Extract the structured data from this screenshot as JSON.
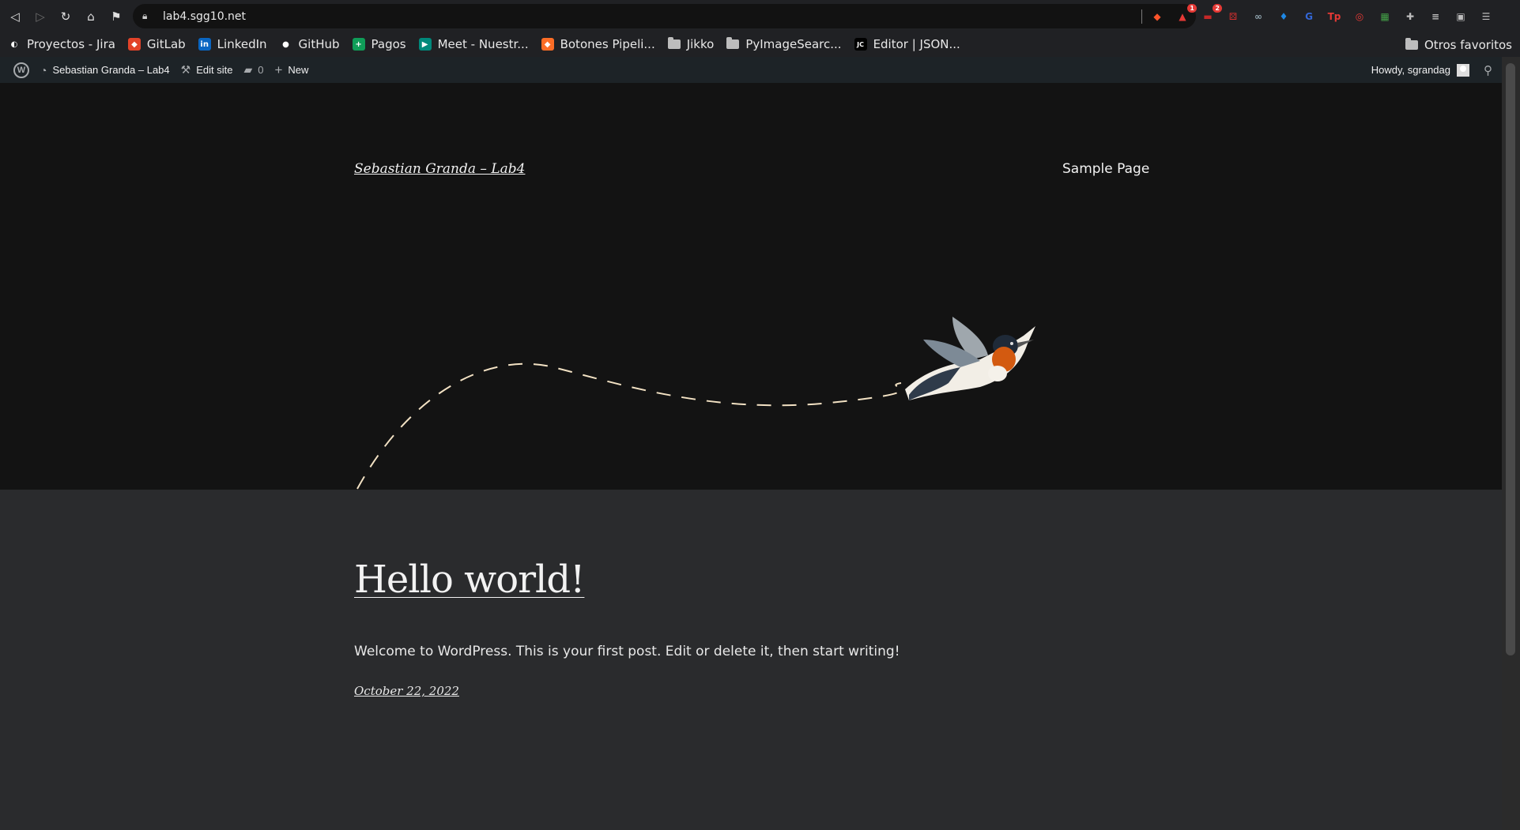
{
  "browser": {
    "url": "lab4.sgg10.net",
    "extensions": [
      {
        "name": "brave-icon",
        "color": "#fb542b",
        "glyph": "◆",
        "badge": ""
      },
      {
        "name": "alert-icon",
        "color": "#e53935",
        "glyph": "▲",
        "badge": "1"
      },
      {
        "name": "dashes-icon",
        "color": "#c62828",
        "glyph": "▬",
        "badge": "2"
      },
      {
        "name": "dice-icon",
        "color": "#d32f2f",
        "glyph": "⚄",
        "badge": ""
      },
      {
        "name": "glasses-icon",
        "color": "#90a4ae",
        "glyph": "∞",
        "badge": ""
      },
      {
        "name": "diamond-icon",
        "color": "#1e88e5",
        "glyph": "♦",
        "badge": ""
      },
      {
        "name": "translate-icon",
        "color": "#3367d6",
        "glyph": "G",
        "badge": ""
      },
      {
        "name": "tp-icon",
        "color": "#e53935",
        "glyph": "Tp",
        "badge": ""
      },
      {
        "name": "ring-icon",
        "color": "#e53935",
        "glyph": "◎",
        "badge": ""
      },
      {
        "name": "map-icon",
        "color": "#43a047",
        "glyph": "▦",
        "badge": ""
      },
      {
        "name": "puzzle-icon",
        "color": "#bdbdbd",
        "glyph": "✚",
        "badge": ""
      },
      {
        "name": "queue-icon",
        "color": "#bdbdbd",
        "glyph": "≡",
        "badge": ""
      },
      {
        "name": "wallet-icon",
        "color": "#bdbdbd",
        "glyph": "▣",
        "badge": ""
      },
      {
        "name": "menu-icon",
        "color": "#bdbdbd",
        "glyph": "☰",
        "badge": ""
      }
    ]
  },
  "bookmarks": [
    {
      "label": "Proyectos - Jira",
      "icon": "jira-icon",
      "color": "#ffffff",
      "glyph": "◐"
    },
    {
      "label": "GitLab",
      "icon": "gitlab-icon",
      "color": "#e24329",
      "glyph": "◆"
    },
    {
      "label": "LinkedIn",
      "icon": "linkedin-icon",
      "color": "#0a66c2",
      "glyph": "in"
    },
    {
      "label": "GitHub",
      "icon": "github-icon",
      "color": "#ffffff",
      "glyph": "●"
    },
    {
      "label": "Pagos",
      "icon": "sheets-icon",
      "color": "#0f9d58",
      "glyph": "+"
    },
    {
      "label": "Meet - Nuestr...",
      "icon": "meet-icon",
      "color": "#00897b",
      "glyph": "▶"
    },
    {
      "label": "Botones Pipeli...",
      "icon": "gitlab-icon",
      "color": "#fc6d26",
      "glyph": "◆"
    },
    {
      "label": "Jikko",
      "icon": "folder-icon",
      "color": "",
      "glyph": ""
    },
    {
      "label": "PyImageSearc...",
      "icon": "folder-icon",
      "color": "",
      "glyph": ""
    },
    {
      "label": "Editor | JSON...",
      "icon": "jsoncrack-icon",
      "color": "#111111",
      "glyph": "JC"
    }
  ],
  "other_bookmarks": "Otros favoritos",
  "admin_bar": {
    "site_name": "Sebastian Granda – Lab4",
    "edit_site": "Edit site",
    "comments_count": "0",
    "new_label": "New",
    "howdy": "Howdy, sgrandag"
  },
  "site": {
    "title": "Sebastian Granda – Lab4",
    "nav_link": "Sample Page"
  },
  "post": {
    "title": "Hello world!",
    "body": "Welcome to WordPress. This is your first post. Edit or delete it, then start writing!",
    "date": "October 22, 2022"
  }
}
